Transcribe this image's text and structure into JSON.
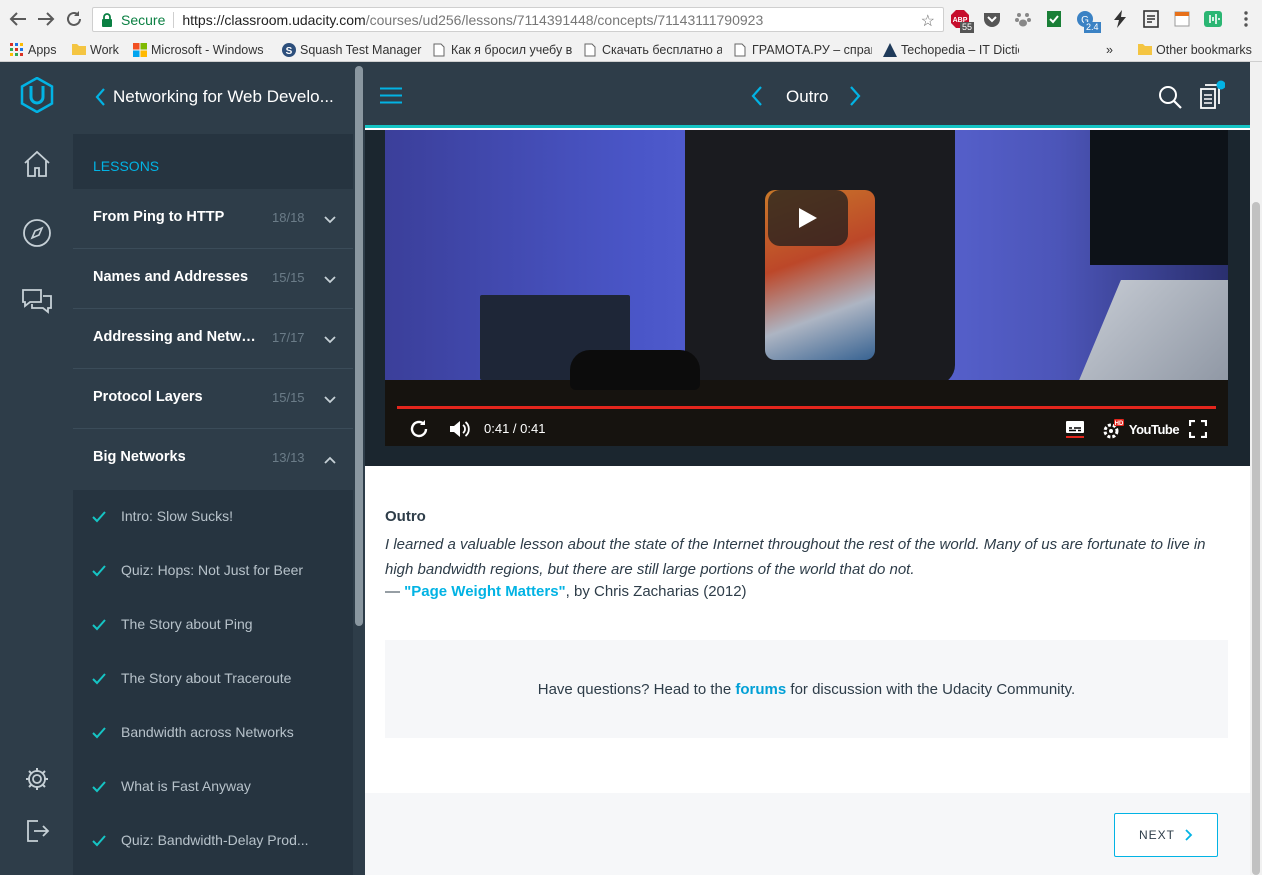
{
  "browser": {
    "secure_label": "Secure",
    "url_host": "https://classroom.udacity.com",
    "url_path": "/courses/ud256/lessons/7114391448/concepts/71143111790923",
    "extension_badges": [
      "55",
      "2.4"
    ],
    "bookmarks": [
      {
        "label": "Apps"
      },
      {
        "label": "Work"
      },
      {
        "label": "Microsoft - Windows"
      },
      {
        "label": "Squash Test Manager"
      },
      {
        "label": "Как я бросил учебу в"
      },
      {
        "label": "Скачать бесплатно ан"
      },
      {
        "label": "ГРАМОТА.РУ – справ"
      },
      {
        "label": "Techopedia – IT Dictio"
      }
    ],
    "overflow": "»",
    "other_bookmarks": "Other bookmarks"
  },
  "sidebar": {
    "course_title": "Networking for Web Develo...",
    "lessons_label": "LESSONS",
    "lessons": [
      {
        "name": "From Ping to HTTP",
        "count": "18/18",
        "expanded": false
      },
      {
        "name": "Names and Addresses",
        "count": "15/15",
        "expanded": false
      },
      {
        "name": "Addressing and Networ...",
        "count": "17/17",
        "expanded": false
      },
      {
        "name": "Protocol Layers",
        "count": "15/15",
        "expanded": false
      },
      {
        "name": "Big Networks",
        "count": "13/13",
        "expanded": true
      }
    ],
    "concepts": [
      {
        "name": "Intro: Slow Sucks!"
      },
      {
        "name": "Quiz: Hops: Not Just for Beer"
      },
      {
        "name": "The Story about Ping"
      },
      {
        "name": "The Story about Traceroute"
      },
      {
        "name": "Bandwidth across Networks"
      },
      {
        "name": "What is Fast Anyway"
      },
      {
        "name": "Quiz: Bandwidth-Delay Prod..."
      }
    ]
  },
  "topbar": {
    "concept_title": "Outro"
  },
  "video": {
    "time": "0:41 / 0:41",
    "progress": 1.0,
    "youtube_label": "YouTube"
  },
  "content": {
    "title": "Outro",
    "quote": "I learned a valuable lesson about the state of the Internet throughout the rest of the world. Many of us are fortunate to live in high bandwidth regions, but there are still large portions of the world that do not.",
    "attr_dash": "— ",
    "attr_link": "\"Page Weight Matters\"",
    "attr_rest": ", by Chris Zacharias (2012)",
    "questions_pre": "Have questions? Head to the ",
    "questions_link": "forums",
    "questions_post": " for discussion with the Udacity Community."
  },
  "footer": {
    "next_label": "NEXT"
  },
  "colors": {
    "accent": "#02b3e4",
    "teal": "#15c5c5",
    "dark": "#2e3d49",
    "check": "#15c5c5"
  }
}
